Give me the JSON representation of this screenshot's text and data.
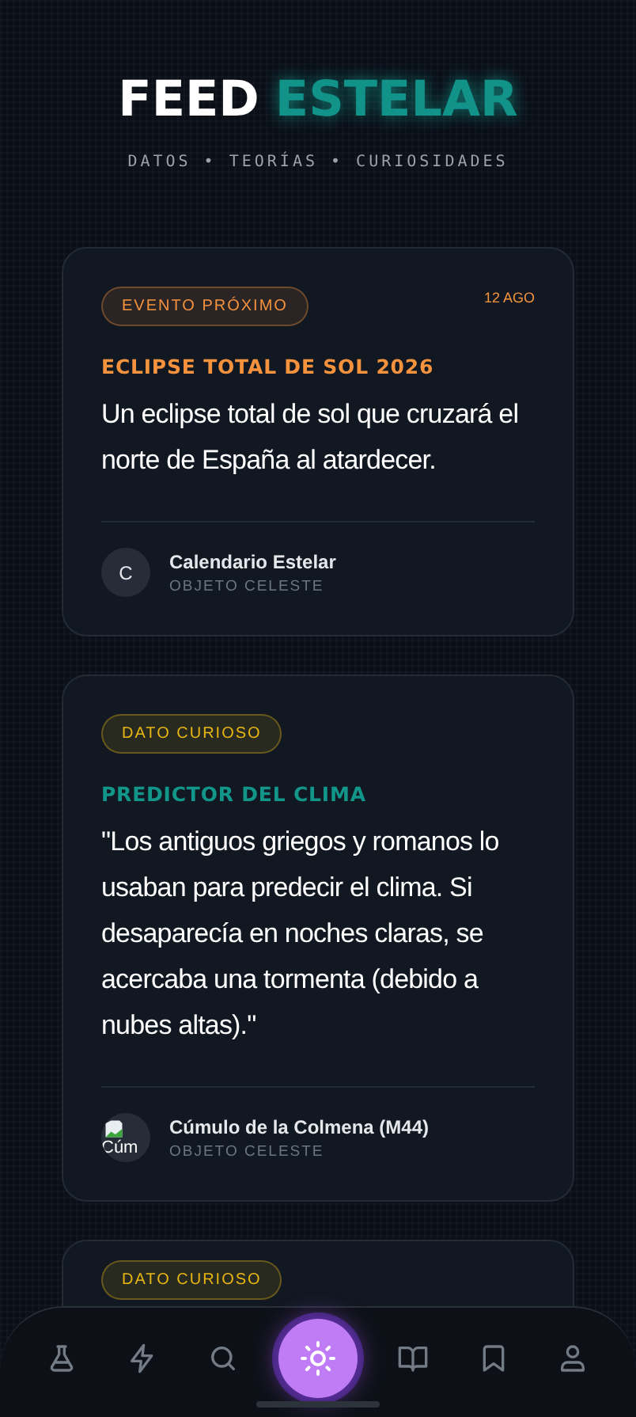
{
  "header": {
    "title_main": "FEED",
    "title_accent": "ESTELAR",
    "subtitle": "DATOS • TEORÍAS • CURIOSIDADES"
  },
  "cards": [
    {
      "tag": {
        "label": "EVENTO PRÓXIMO",
        "color": "#f5923e"
      },
      "date": "12 AGO",
      "title": {
        "text": "ECLIPSE TOTAL DE SOL 2026",
        "color": "#f5923e"
      },
      "body": "Un eclipse total de sol que cruzará el norte de España al atardecer.",
      "author": {
        "name": "Calendario Estelar",
        "role": "OBJETO CELESTE",
        "avatar": {
          "kind": "initial",
          "text": "C"
        }
      }
    },
    {
      "tag": {
        "label": "DATO CURIOSO",
        "color": "#e8b714"
      },
      "title": {
        "text": "PREDICTOR DEL CLIMA",
        "color": "#13968a"
      },
      "body": "\"Los antiguos griegos y romanos lo usaban para predecir el clima. Si desaparecía en noches claras, se acercaba una tormenta (debido a nubes altas).\"",
      "author": {
        "name": "Cúmulo de la Colmena (M44)",
        "role": "OBJETO CELESTE",
        "avatar": {
          "kind": "broken-image",
          "text": "Cúm"
        }
      }
    },
    {
      "tag": {
        "label": "DATO CURIOSO",
        "color": "#e8b714"
      }
    }
  ],
  "nav": [
    {
      "kind": "flask",
      "selected": false
    },
    {
      "kind": "bolt",
      "selected": false
    },
    {
      "kind": "search",
      "selected": false
    },
    {
      "kind": "sun",
      "selected": true
    },
    {
      "kind": "book",
      "selected": false
    },
    {
      "kind": "bookmark",
      "selected": false
    },
    {
      "kind": "user",
      "selected": false
    }
  ]
}
